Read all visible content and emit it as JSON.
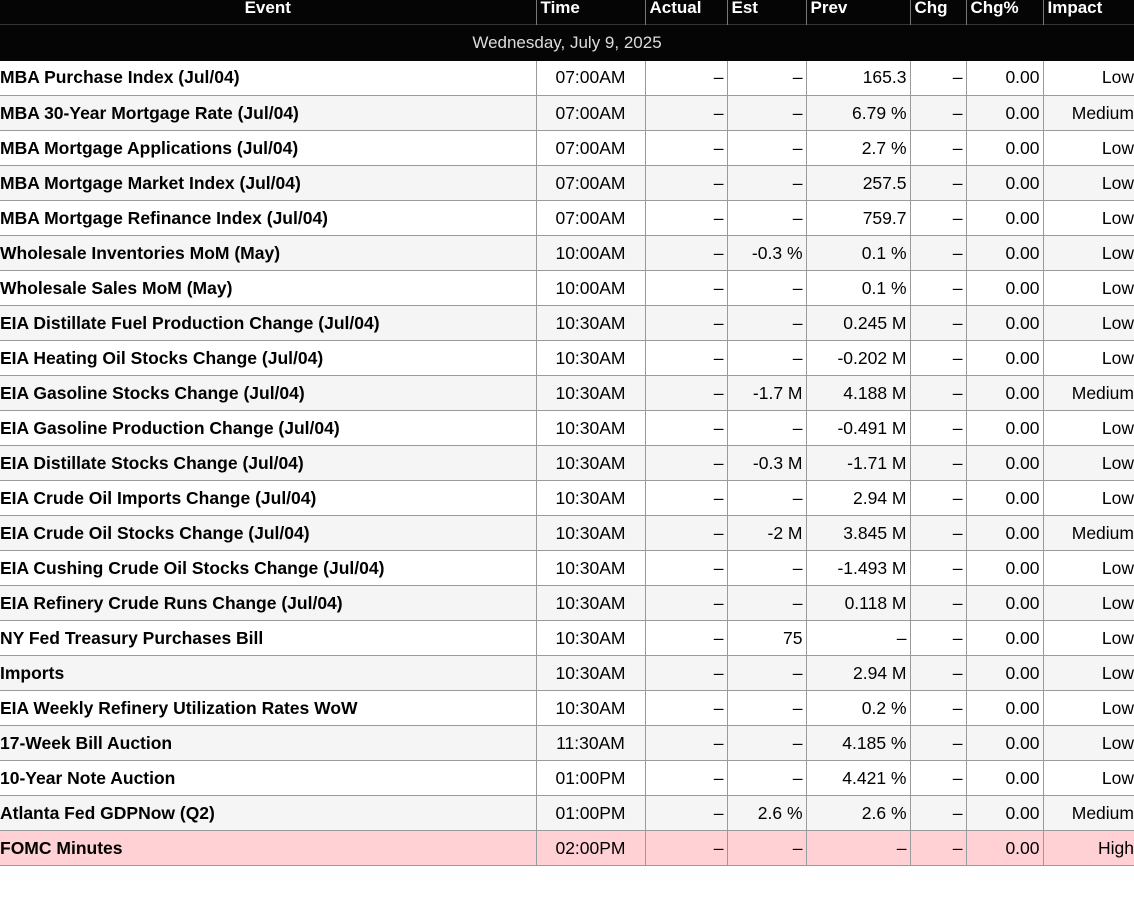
{
  "columns": {
    "event": "Event",
    "time": "Time",
    "actual": "Actual",
    "est": "Est",
    "prev": "Prev",
    "chg": "Chg",
    "chg_pct": "Chg%",
    "impact": "Impact"
  },
  "date_header": "Wednesday, July 9, 2025",
  "colors": {
    "header_bg": "#050505",
    "row_alt": "#f5f5f5",
    "high_impact_row": "#ffd0d4"
  },
  "rows": [
    {
      "event": "MBA Purchase Index (Jul/04)",
      "time": "07:00AM",
      "actual": "–",
      "est": "–",
      "prev": "165.3",
      "chg": "–",
      "chg_pct": "0.00",
      "impact": "Low"
    },
    {
      "event": "MBA 30-Year Mortgage Rate (Jul/04)",
      "time": "07:00AM",
      "actual": "–",
      "est": "–",
      "prev": "6.79 %",
      "chg": "–",
      "chg_pct": "0.00",
      "impact": "Medium"
    },
    {
      "event": "MBA Mortgage Applications (Jul/04)",
      "time": "07:00AM",
      "actual": "–",
      "est": "–",
      "prev": "2.7 %",
      "chg": "–",
      "chg_pct": "0.00",
      "impact": "Low"
    },
    {
      "event": "MBA Mortgage Market Index (Jul/04)",
      "time": "07:00AM",
      "actual": "–",
      "est": "–",
      "prev": "257.5",
      "chg": "–",
      "chg_pct": "0.00",
      "impact": "Low"
    },
    {
      "event": "MBA Mortgage Refinance Index (Jul/04)",
      "time": "07:00AM",
      "actual": "–",
      "est": "–",
      "prev": "759.7",
      "chg": "–",
      "chg_pct": "0.00",
      "impact": "Low"
    },
    {
      "event": "Wholesale Inventories MoM (May)",
      "time": "10:00AM",
      "actual": "–",
      "est": "-0.3 %",
      "prev": "0.1 %",
      "chg": "–",
      "chg_pct": "0.00",
      "impact": "Low"
    },
    {
      "event": "Wholesale Sales MoM (May)",
      "time": "10:00AM",
      "actual": "–",
      "est": "–",
      "prev": "0.1 %",
      "chg": "–",
      "chg_pct": "0.00",
      "impact": "Low"
    },
    {
      "event": "EIA Distillate Fuel Production Change (Jul/04)",
      "time": "10:30AM",
      "actual": "–",
      "est": "–",
      "prev": "0.245 M",
      "chg": "–",
      "chg_pct": "0.00",
      "impact": "Low"
    },
    {
      "event": "EIA Heating Oil Stocks Change (Jul/04)",
      "time": "10:30AM",
      "actual": "–",
      "est": "–",
      "prev": "-0.202 M",
      "chg": "–",
      "chg_pct": "0.00",
      "impact": "Low"
    },
    {
      "event": "EIA Gasoline Stocks Change (Jul/04)",
      "time": "10:30AM",
      "actual": "–",
      "est": "-1.7 M",
      "prev": "4.188 M",
      "chg": "–",
      "chg_pct": "0.00",
      "impact": "Medium"
    },
    {
      "event": "EIA Gasoline Production Change (Jul/04)",
      "time": "10:30AM",
      "actual": "–",
      "est": "–",
      "prev": "-0.491 M",
      "chg": "–",
      "chg_pct": "0.00",
      "impact": "Low"
    },
    {
      "event": "EIA Distillate Stocks Change (Jul/04)",
      "time": "10:30AM",
      "actual": "–",
      "est": "-0.3 M",
      "prev": "-1.71 M",
      "chg": "–",
      "chg_pct": "0.00",
      "impact": "Low"
    },
    {
      "event": "EIA Crude Oil Imports Change (Jul/04)",
      "time": "10:30AM",
      "actual": "–",
      "est": "–",
      "prev": "2.94 M",
      "chg": "–",
      "chg_pct": "0.00",
      "impact": "Low"
    },
    {
      "event": "EIA Crude Oil Stocks Change (Jul/04)",
      "time": "10:30AM",
      "actual": "–",
      "est": "-2 M",
      "prev": "3.845 M",
      "chg": "–",
      "chg_pct": "0.00",
      "impact": "Medium"
    },
    {
      "event": "EIA Cushing Crude Oil Stocks Change (Jul/04)",
      "time": "10:30AM",
      "actual": "–",
      "est": "–",
      "prev": "-1.493 M",
      "chg": "–",
      "chg_pct": "0.00",
      "impact": "Low"
    },
    {
      "event": "EIA Refinery Crude Runs Change (Jul/04)",
      "time": "10:30AM",
      "actual": "–",
      "est": "–",
      "prev": "0.118 M",
      "chg": "–",
      "chg_pct": "0.00",
      "impact": "Low"
    },
    {
      "event": "NY Fed Treasury Purchases Bill",
      "time": "10:30AM",
      "actual": "–",
      "est": "75",
      "prev": "–",
      "chg": "–",
      "chg_pct": "0.00",
      "impact": "Low"
    },
    {
      "event": "Imports",
      "time": "10:30AM",
      "actual": "–",
      "est": "–",
      "prev": "2.94 M",
      "chg": "–",
      "chg_pct": "0.00",
      "impact": "Low"
    },
    {
      "event": "EIA Weekly Refinery Utilization Rates WoW",
      "time": "10:30AM",
      "actual": "–",
      "est": "–",
      "prev": "0.2 %",
      "chg": "–",
      "chg_pct": "0.00",
      "impact": "Low"
    },
    {
      "event": "17-Week Bill Auction",
      "time": "11:30AM",
      "actual": "–",
      "est": "–",
      "prev": "4.185 %",
      "chg": "–",
      "chg_pct": "0.00",
      "impact": "Low"
    },
    {
      "event": "10-Year Note Auction",
      "time": "01:00PM",
      "actual": "–",
      "est": "–",
      "prev": "4.421 %",
      "chg": "–",
      "chg_pct": "0.00",
      "impact": "Low"
    },
    {
      "event": "Atlanta Fed GDPNow (Q2)",
      "time": "01:00PM",
      "actual": "–",
      "est": "2.6 %",
      "prev": "2.6 %",
      "chg": "–",
      "chg_pct": "0.00",
      "impact": "Medium"
    },
    {
      "event": "FOMC Minutes",
      "time": "02:00PM",
      "actual": "–",
      "est": "–",
      "prev": "–",
      "chg": "–",
      "chg_pct": "0.00",
      "impact": "High"
    }
  ]
}
